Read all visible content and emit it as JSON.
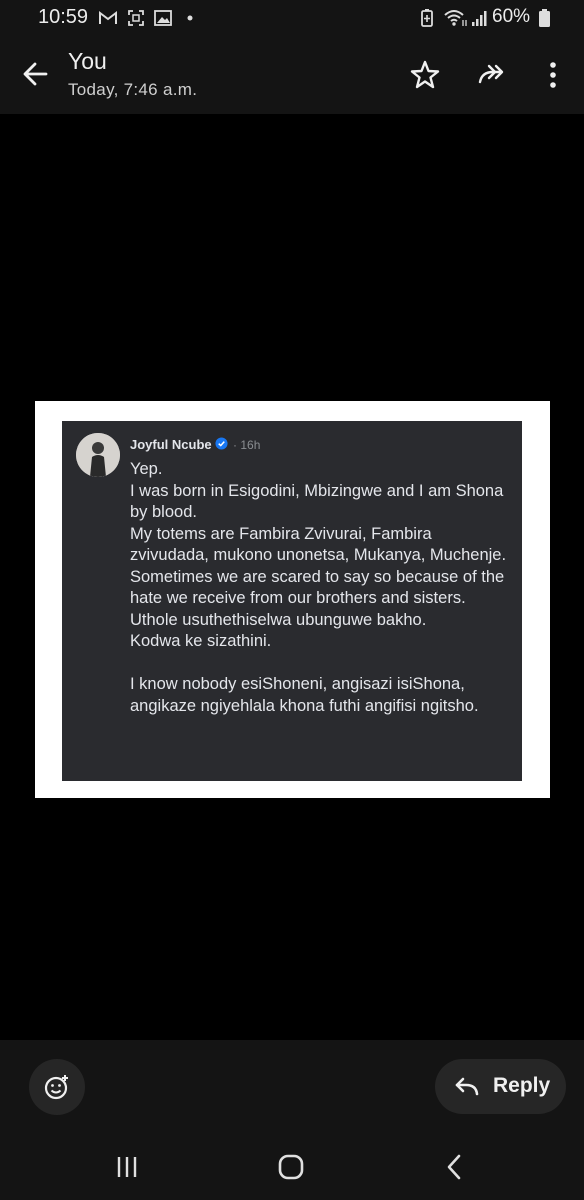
{
  "status_bar": {
    "time": "10:59",
    "battery": "60%",
    "icons": [
      "gmail-icon",
      "screenshot-icon",
      "gallery-icon",
      "dot-icon",
      "battery-saver-icon",
      "wifi-icon",
      "signal-icon",
      "battery-icon"
    ]
  },
  "header": {
    "sender": "You",
    "timestamp": "Today, 7:46 a.m.",
    "actions": [
      "back-icon",
      "star-icon",
      "forward-icon",
      "more-icon"
    ]
  },
  "post": {
    "author": "Joyful Ncube",
    "age": "16h",
    "text": "Yep.\nI was born in Esigodini, Mbizingwe and I am Shona by blood.\nMy totems are Fambira Zvivurai, Fambira zvivudada, mukono unonetsa, Mukanya, Muchenje.\nSometimes we are scared to say so because of the hate we receive from our brothers and sisters. Uthole usuthethiselwa ubunguwe bakho.\nKodwa ke sizathini.\n\nI know nobody esiShoneni, angisazi isiShona, angikaze ngiyehlala khona futhi angifisi ngitsho."
  },
  "footer": {
    "reply_label": "Reply"
  },
  "colors": {
    "background": "#000000",
    "bar": "#141414",
    "button": "#262626",
    "post_bg": "#2a2b2f",
    "verified": "#1877f2"
  }
}
